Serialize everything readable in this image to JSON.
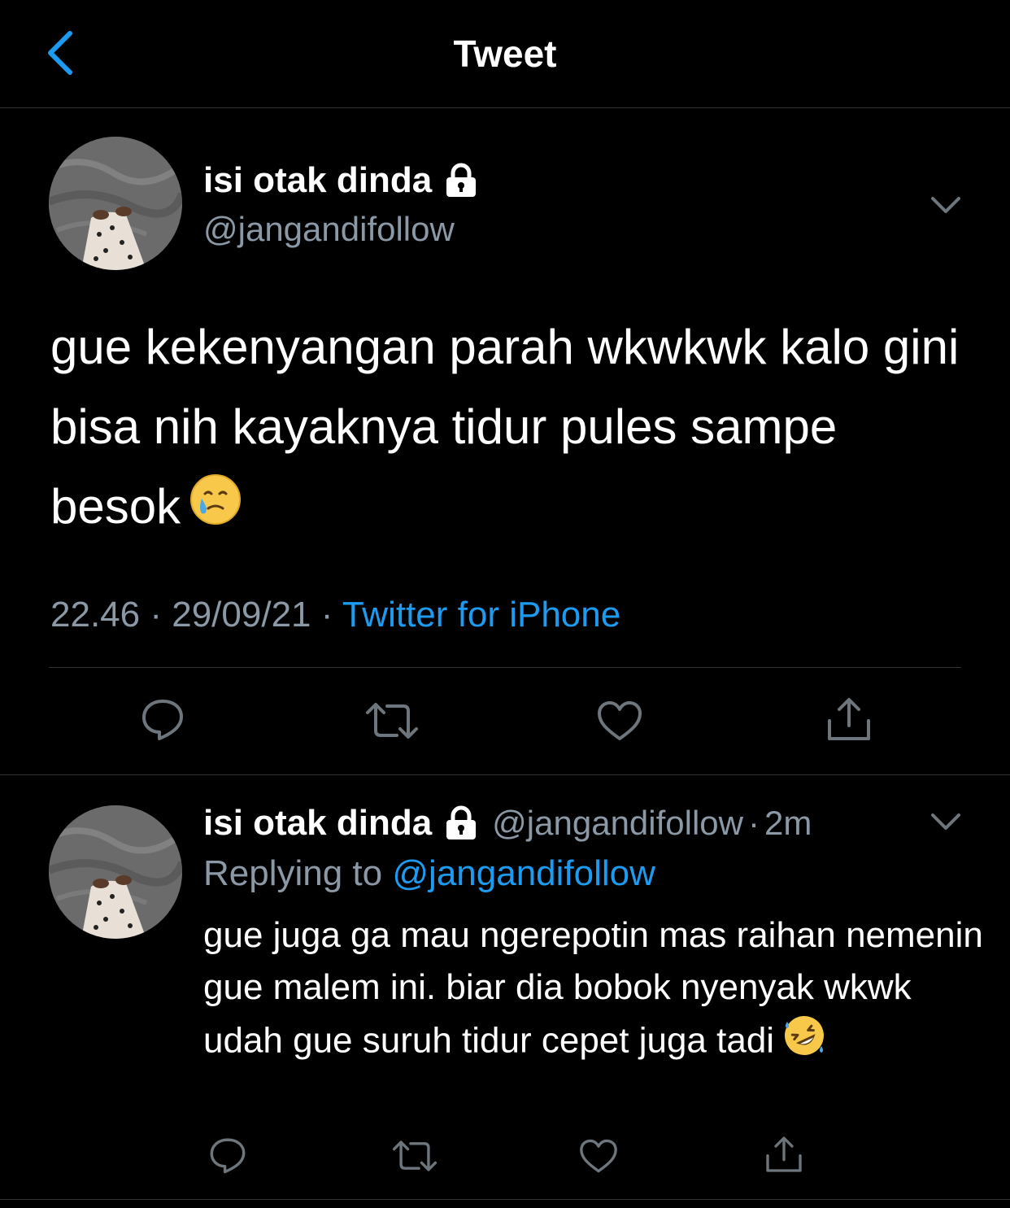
{
  "header": {
    "title": "Tweet",
    "back_icon": "chevron-left-icon"
  },
  "colors": {
    "background": "#000000",
    "text": "#ffffff",
    "secondary": "#8b98a5",
    "accent": "#1d9bf0",
    "divider": "#2f3336"
  },
  "main_tweet": {
    "display_name": "isi otak dinda",
    "handle": "@jangandifollow",
    "text": "gue kekenyangan parah wkwkwk kalo gini bisa nih kayaknya tidur pules sampe besok",
    "emoji": "face-holding-back-tears",
    "time": "22.46",
    "separator": "·",
    "date": "29/09/21",
    "source": "Twitter for iPhone",
    "actions": [
      "reply-icon",
      "retweet-icon",
      "like-icon",
      "share-icon"
    ]
  },
  "reply_tweet": {
    "display_name": "isi otak dinda",
    "handle": "@jangandifollow",
    "separator": "·",
    "age": "2m",
    "replying_label": "Replying to",
    "replying_to": "@jangandifollow",
    "text": "gue juga ga mau ngerepotin mas raihan nemenin gue malem ini. biar dia bobok nyenyak wkwk udah gue suruh tidur cepet juga tadi",
    "emoji": "rolling-on-the-floor-laughing",
    "actions": [
      "reply-icon",
      "retweet-icon",
      "like-icon",
      "share-icon"
    ]
  }
}
